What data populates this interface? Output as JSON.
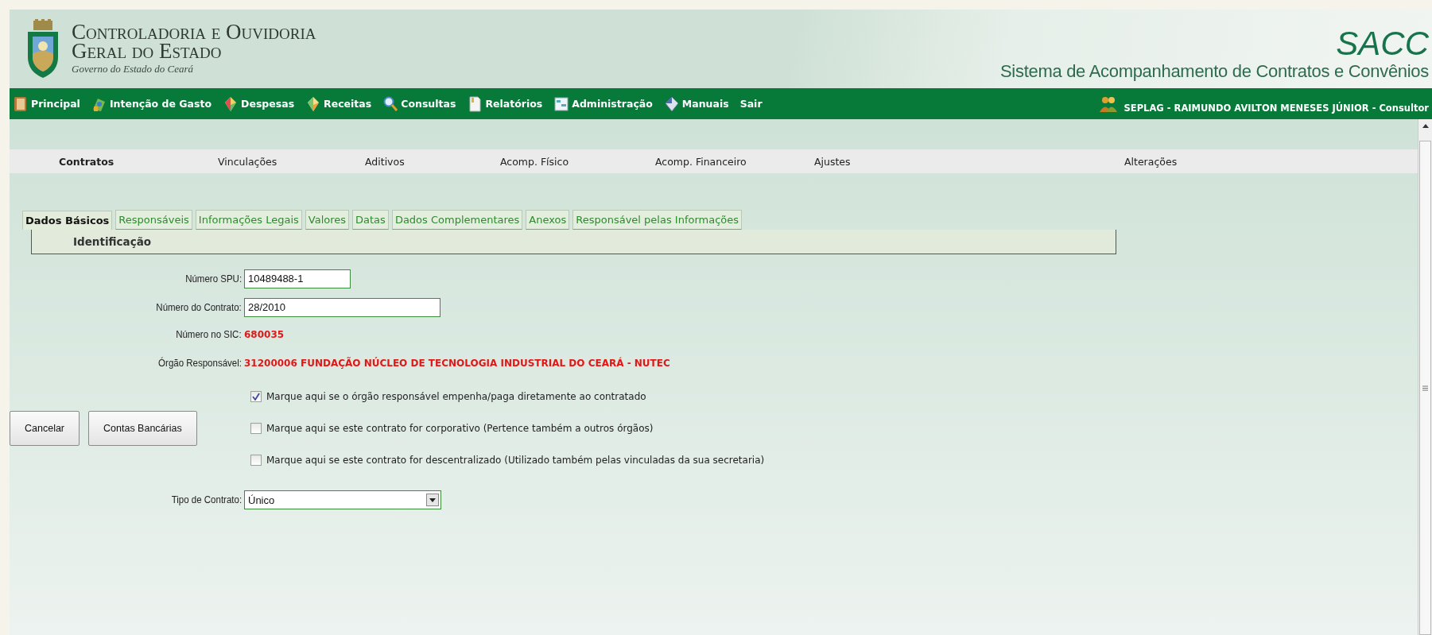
{
  "header": {
    "org_lines": [
      "Controladoria e Ouvidoria",
      "Geral do Estado"
    ],
    "org_subtitle": "Governo do Estado do Ceará",
    "app_name": "SACC",
    "app_full_name": "Sistema de Acompanhamento de Contratos e Convênios"
  },
  "menu": {
    "items": [
      {
        "label": "Principal"
      },
      {
        "label": "Intenção de Gasto"
      },
      {
        "label": "Despesas"
      },
      {
        "label": "Receitas"
      },
      {
        "label": "Consultas"
      },
      {
        "label": "Relatórios"
      },
      {
        "label": "Administração"
      },
      {
        "label": "Manuais"
      },
      {
        "label": "Sair"
      }
    ],
    "user": "SEPLAG  -  RAIMUNDO AVILTON MENESES JÚNIOR  -  Consultor"
  },
  "subnav": [
    {
      "label": "Contratos",
      "selected": true
    },
    {
      "label": "Vinculações",
      "selected": false
    },
    {
      "label": "Aditivos",
      "selected": false
    },
    {
      "label": "Acomp. Físico",
      "selected": false
    },
    {
      "label": "Acomp. Financeiro",
      "selected": false
    },
    {
      "label": "Ajustes",
      "selected": false
    },
    {
      "label": "Alterações",
      "selected": false
    }
  ],
  "tabs": [
    {
      "label": "Dados Básicos",
      "selected": true
    },
    {
      "label": "Responsáveis",
      "selected": false
    },
    {
      "label": "Informações Legais",
      "selected": false
    },
    {
      "label": "Valores",
      "selected": false
    },
    {
      "label": "Datas",
      "selected": false
    },
    {
      "label": "Dados Complementares",
      "selected": false
    },
    {
      "label": "Anexos",
      "selected": false
    },
    {
      "label": "Responsável pelas Informações",
      "selected": false
    }
  ],
  "section_title": "Identificação",
  "fields": [
    {
      "kind": "input",
      "label": "Número SPU:",
      "value": "10489488-1"
    },
    {
      "kind": "input",
      "label": "Número do Contrato:",
      "value": "28/2010"
    },
    {
      "kind": "text",
      "label": "Número no SIC:",
      "value": "680035"
    },
    {
      "kind": "text",
      "label": "Órgão Responsável:",
      "value": "31200006 FUNDAÇÃO NÚCLEO DE TECNOLOGIA INDUSTRIAL DO CEARÁ - NUTEC"
    }
  ],
  "checkboxes": [
    {
      "label": "Marque aqui se o órgão responsável empenha/paga diretamente ao contratado",
      "checked": true
    },
    {
      "label": "Marque aqui se este contrato for corporativo (Pertence também a outros órgãos)",
      "checked": false
    },
    {
      "label": "Marque aqui se este contrato for descentralizado (Utilizado também pelas vinculadas da sua secretaria)",
      "checked": false
    }
  ],
  "buttons": [
    "Cancelar",
    "Contas Bancárias"
  ],
  "contract_type": {
    "label": "Tipo de Contrato:",
    "value": "Único"
  }
}
